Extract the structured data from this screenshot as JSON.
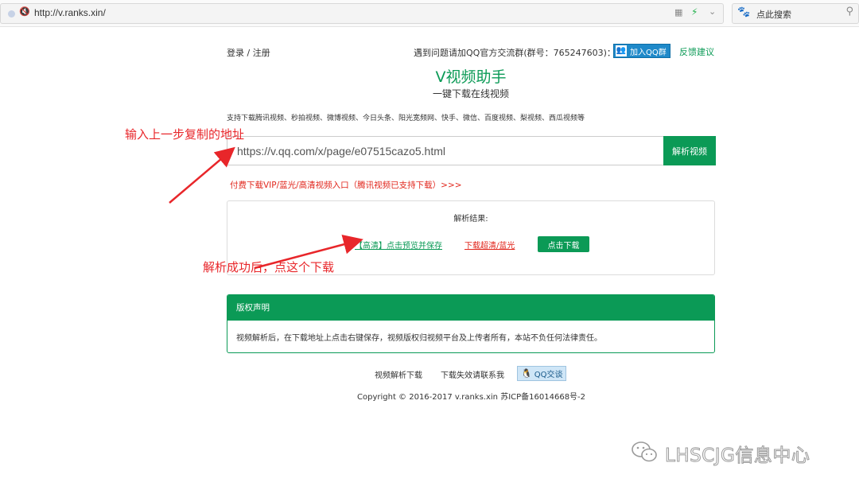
{
  "browser": {
    "url": "http://v.ranks.xin/",
    "search_placeholder": "点此搜索"
  },
  "header": {
    "login": "登录 / 注册",
    "qq_group_text": "遇到问题请加QQ官方交流群(群号：765247603)：",
    "join_qq_label": "加入QQ群",
    "feedback": "反馈建议"
  },
  "title": {
    "main": "V视频助手",
    "sub": "一键下载在线视频"
  },
  "platforms": "支持下载腾讯视频、秒拍视频、微博视频、今日头条、阳光宽频网、快手、微信、百度视频、梨视频、西瓜视频等",
  "input": {
    "value": "https://v.qq.com/x/page/e07515cazo5.html",
    "button": "解析视频"
  },
  "vip_link": "付费下载VIP/蓝光/高清视频入口（腾讯视频已支持下载）>>>",
  "result": {
    "title": "解析结果:",
    "hd_link": "【高清】点击预览并保存",
    "superhd_link": "下载超清/蓝光",
    "download_button": "点击下载"
  },
  "copyright_panel": {
    "heading": "版权声明",
    "body": "视频解析后，在下载地址上点击右键保存，视频版权归视频平台及上传者所有，本站不负任何法律责任。"
  },
  "footer": {
    "link1": "视频解析下载",
    "link2": "下载失效请联系我",
    "qq_chat": "QQ交谈",
    "copyright": "Copyright © 2016-2017 v.ranks.xin 苏ICP备16014668号-2"
  },
  "annotations": {
    "step1": "输入上一步复制的地址",
    "step2": "解析成功后，点这个下载"
  },
  "watermark": "LHSCJG信息中心",
  "colors": {
    "brand_green": "#0b9a56",
    "annotation_red": "#e8262a",
    "link_red": "#e1261c"
  }
}
